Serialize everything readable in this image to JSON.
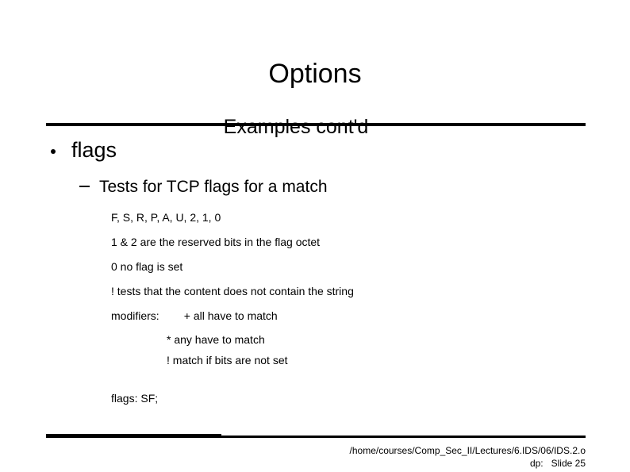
{
  "slide": {
    "title": "Options",
    "subtitle": "Examples cont'd",
    "bullets": {
      "level1": "flags",
      "level2": "Tests for TCP flags for a match",
      "details": [
        "F, S, R, P, A, U, 2, 1, 0",
        "1 & 2 are the reserved bits in the flag octet",
        "0 no flag is set",
        "! tests that the content does not contain the string",
        "modifiers:        + all have to match"
      ],
      "modifier_sublines": [
        "* any have to match",
        "! match if bits are not set"
      ],
      "example": "flags: SF;"
    },
    "footer": {
      "path": "/home/courses/Comp_Sec_II/Lectures/6.IDS/06/IDS.2.o",
      "slide_label": "dp:   Slide 25"
    },
    "colors": {
      "text": "#000000",
      "background": "#ffffff",
      "rule": "#000000"
    }
  }
}
